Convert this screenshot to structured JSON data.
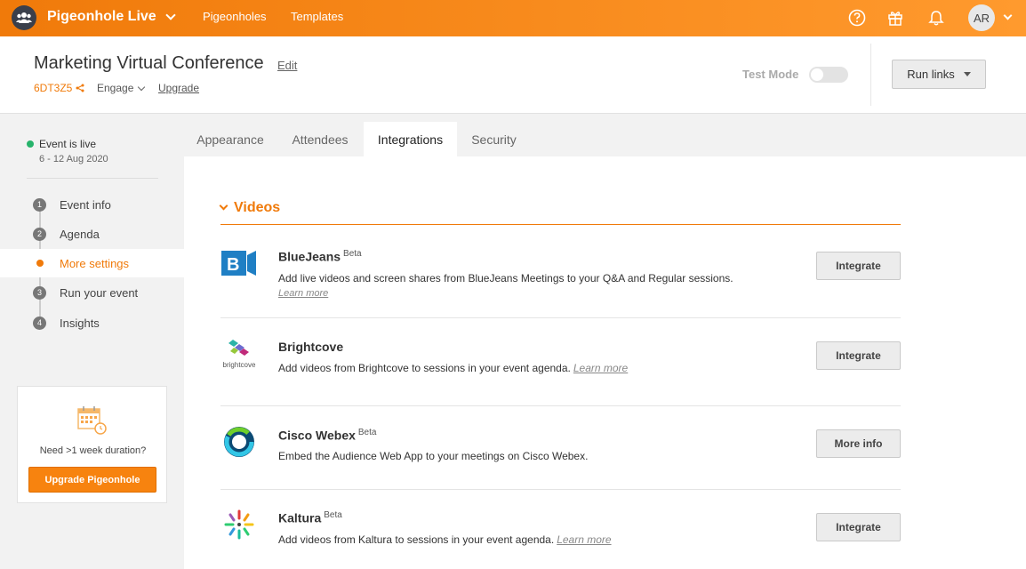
{
  "topbar": {
    "brand": "Pigeonhole Live",
    "nav": [
      "Pigeonholes",
      "Templates"
    ],
    "avatar_initials": "AR",
    "icons": [
      "help-icon",
      "gift-icon",
      "bell-icon"
    ]
  },
  "header": {
    "event_title": "Marketing Virtual Conference",
    "edit_label": "Edit",
    "event_code": "6DT3Z5",
    "engage_label": "Engage",
    "upgrade_label": "Upgrade",
    "test_mode_label": "Test Mode",
    "test_mode_on": false,
    "run_links_label": "Run links"
  },
  "sidebar": {
    "status": "Event is live",
    "dates": "6 - 12 Aug 2020",
    "steps": [
      {
        "num": "1",
        "label": "Event info"
      },
      {
        "num": "2",
        "label": "Agenda"
      },
      {
        "num": "",
        "label": "More settings",
        "active": true
      },
      {
        "num": "3",
        "label": "Run your event"
      },
      {
        "num": "4",
        "label": "Insights"
      }
    ],
    "promo": {
      "question": "Need >1 week duration?",
      "button": "Upgrade Pigeonhole"
    }
  },
  "tabs": [
    {
      "label": "Appearance"
    },
    {
      "label": "Attendees"
    },
    {
      "label": "Integrations",
      "active": true
    },
    {
      "label": "Security"
    }
  ],
  "main": {
    "section_title": "Videos",
    "integrations": [
      {
        "name": "BlueJeans",
        "badge": "Beta",
        "desc": "Add live videos and screen shares from BlueJeans Meetings to your Q&A and Regular sessions.",
        "learn_more": "Learn more",
        "button": "Integrate"
      },
      {
        "name": "Brightcove",
        "badge": "",
        "logo_caption": "brightcove",
        "desc": "Add videos from Brightcove to sessions in your event agenda.",
        "learn_more": "Learn more",
        "button": "Integrate"
      },
      {
        "name": "Cisco Webex",
        "badge": "Beta",
        "desc": "Embed the Audience Web App to your meetings on Cisco Webex.",
        "learn_more": "",
        "button": "More info"
      },
      {
        "name": "Kaltura",
        "badge": "Beta",
        "desc": "Add videos from Kaltura to sessions in your event agenda.",
        "learn_more": "Learn more",
        "button": "Integrate"
      }
    ]
  },
  "colors": {
    "accent": "#f07a0a",
    "live": "#27b36b",
    "bluejeans": "#1f7fc4"
  }
}
